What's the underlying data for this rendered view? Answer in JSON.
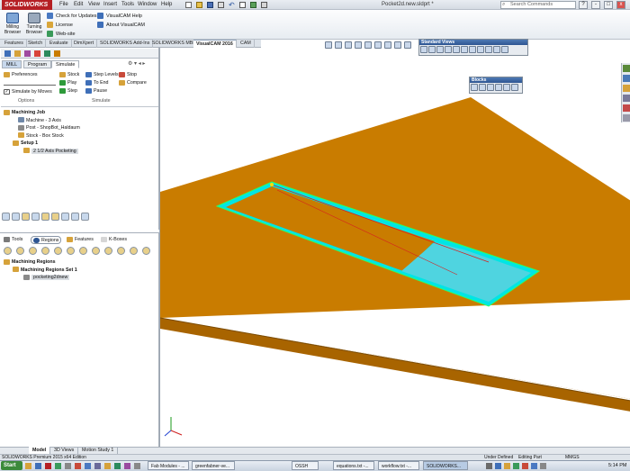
{
  "app": {
    "logo": "SOLIDWORKS",
    "doc_title": "Pocket2d.new.sldprt *"
  },
  "menu": [
    "File",
    "Edit",
    "View",
    "Insert",
    "Tools",
    "Window",
    "Help"
  ],
  "search": {
    "placeholder": "Search Commands"
  },
  "window_buttons": [
    "?",
    "-",
    "□",
    "x"
  ],
  "ribbon": {
    "milling": "Milling Browser",
    "turning": "Turning Browser",
    "help_items": [
      "Check for Updates",
      "License",
      "Web-site"
    ],
    "about_items": [
      "VisualCAM Help",
      "About VisualCAM"
    ]
  },
  "command_tabs": [
    "Features",
    "Sketch",
    "Evaluate",
    "DimXpert",
    "SOLIDWORKS Add-Ins",
    "SOLIDWORKS MBD",
    "VisualCAM 2016",
    "CAM"
  ],
  "active_command_tab": "VisualCAM 2016",
  "floating": {
    "standard_views": "Standard Views",
    "blocks": "Blocks"
  },
  "top_panel": {
    "tabs": [
      "MILL",
      "Program",
      "Simulate"
    ],
    "options": {
      "preferences": "Preferences",
      "simulate_by_moves": "Simulate by Moves",
      "group": "Options"
    },
    "simulate": {
      "buttons": [
        "Stock",
        "Play",
        "Step",
        "Step Levels",
        "To End",
        "Pause",
        "Stop",
        "Compare"
      ],
      "group": "Simulate"
    },
    "tree": [
      {
        "label": "Machining Job",
        "indent": 0,
        "bold": true
      },
      {
        "label": "Machine - 3 Axis",
        "indent": 1
      },
      {
        "label": "Post - ShopBot_Haldaum",
        "indent": 1
      },
      {
        "label": "Stock - Box Stock",
        "indent": 1
      },
      {
        "label": "Setup 1",
        "indent": 1,
        "bold": true
      },
      {
        "label": "2 1/2 Axis Pocketing",
        "indent": 2,
        "selected": true
      }
    ]
  },
  "bottom_panel": {
    "tabs": [
      "Tools",
      "Regions",
      "Features",
      "K-Boxes"
    ],
    "tree": [
      {
        "label": "Machining Regions",
        "indent": 0,
        "bold": true
      },
      {
        "label": "Machining Regions Set 1",
        "indent": 1,
        "bold": true
      },
      {
        "label": "pocketing2dnew",
        "indent": 2,
        "selected": true
      }
    ]
  },
  "model_tabs": [
    "Model",
    "3D Views",
    "Motion Study 1"
  ],
  "status": {
    "left": "SOLIDWORKS Premium 2015 x64 Edition",
    "defined": "Under Defined",
    "editing": "Editing Part",
    "units": "MMGS"
  },
  "taskbar": {
    "start": "Start",
    "items": [
      "Fab Modules - ...",
      "greenfabner-ve...",
      "OSSH",
      "equations.txt -...",
      "workflow.txt -...",
      "SOLIDWORKS..."
    ],
    "active_item": "SOLIDWORKS...",
    "clock": "5:14 PM"
  },
  "colors": {
    "stock": "#c97c00",
    "stock_edge": "#8a5200",
    "toolpath": "#00e5e5",
    "ribbon_accent": "#2d5592"
  }
}
